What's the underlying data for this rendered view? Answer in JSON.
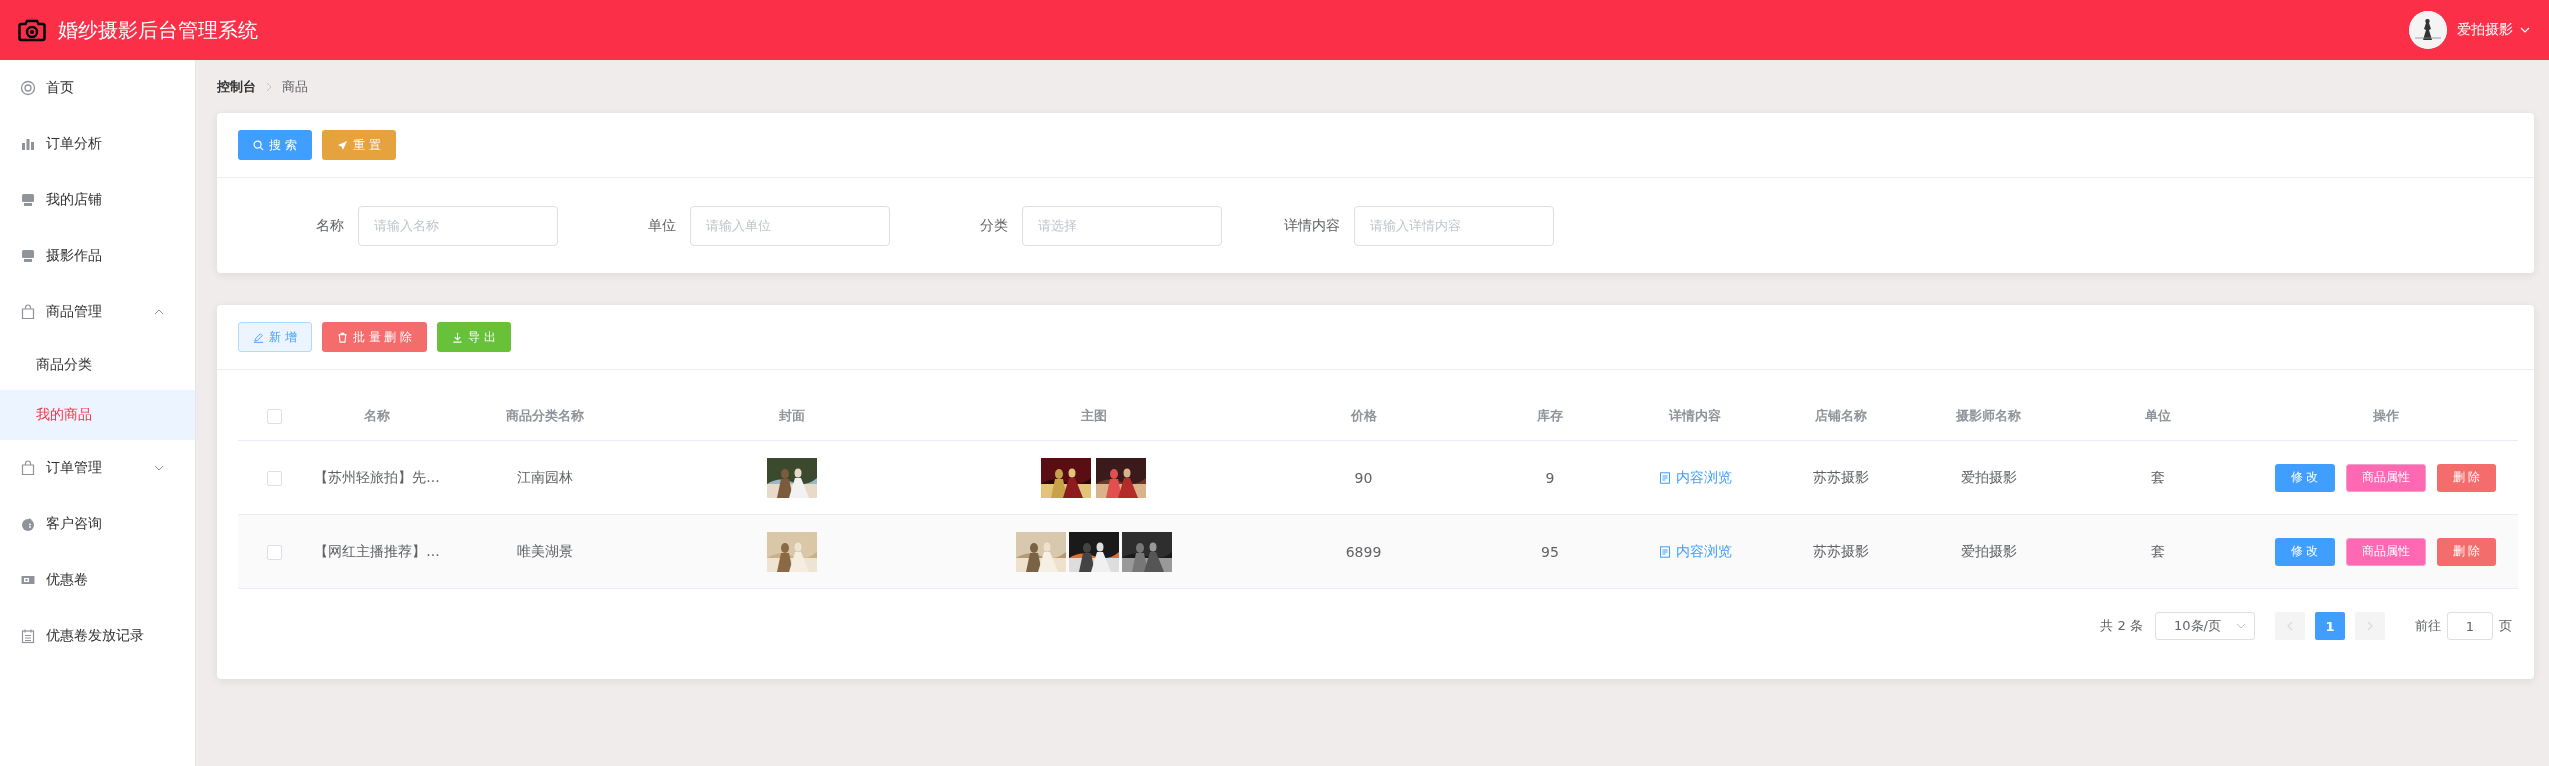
{
  "header": {
    "title": "婚纱摄影后台管理系统",
    "user": "爱拍摄影"
  },
  "sidebar": {
    "items": [
      {
        "label": "首页",
        "selected": false
      },
      {
        "label": "订单分析",
        "selected": false
      },
      {
        "label": "我的店铺",
        "selected": false
      },
      {
        "label": "摄影作品",
        "selected": false
      },
      {
        "label": "商品管理",
        "selected": false,
        "expanded": true,
        "children": [
          {
            "label": "商品分类",
            "selected": false
          },
          {
            "label": "我的商品",
            "selected": true
          }
        ]
      },
      {
        "label": "订单管理",
        "selected": false,
        "expanded": false
      },
      {
        "label": "客户咨询",
        "selected": false
      },
      {
        "label": "优惠卷",
        "selected": false
      },
      {
        "label": "优惠卷发放记录",
        "selected": false
      }
    ]
  },
  "breadcrumb": [
    "控制台",
    "商品"
  ],
  "search_panel": {
    "buttons": [
      {
        "kind": "search",
        "label": "搜 索"
      },
      {
        "kind": "reset",
        "label": "重 置"
      }
    ],
    "fields": [
      {
        "label": "名称",
        "placeholder": "请输入名称"
      },
      {
        "label": "单位",
        "placeholder": "请输入单位"
      },
      {
        "label": "分类",
        "placeholder": "请选择"
      },
      {
        "label": "详情内容",
        "placeholder": "请输入详情内容"
      }
    ]
  },
  "toolbar": [
    {
      "kind": "add",
      "label": "新 增"
    },
    {
      "kind": "batch-delete",
      "label": "批 量 删 除"
    },
    {
      "kind": "export",
      "label": "导 出"
    }
  ],
  "table": {
    "select_all": {
      "checked": false
    },
    "columns": [
      "名称",
      "商品分类名称",
      "封面",
      "主图",
      "价格",
      "库存",
      "详情内容",
      "店铺名称",
      "摄影师名称",
      "单位",
      "操作"
    ],
    "rows": [
      {
        "checked": false,
        "name": "【苏州轻旅拍】先...",
        "category": "江南园林",
        "price": "90",
        "stock": "9",
        "detail_link": "内容浏览",
        "shop": "苏苏摄影",
        "photographer": "爱拍摄影",
        "unit": "套",
        "actions": [
          {
            "kind": "edit",
            "label": "修 改"
          },
          {
            "kind": "attributes",
            "label": "商品属性"
          },
          {
            "kind": "delete",
            "label": "删 除"
          }
        ]
      },
      {
        "checked": false,
        "name": "【网红主播推荐】...",
        "category": "唯美湖景",
        "price": "6899",
        "stock": "95",
        "detail_link": "内容浏览",
        "shop": "苏苏摄影",
        "photographer": "爱拍摄影",
        "unit": "套",
        "actions": [
          {
            "kind": "edit",
            "label": "修 改"
          },
          {
            "kind": "attributes",
            "label": "商品属性"
          },
          {
            "kind": "delete",
            "label": "删 除"
          }
        ]
      }
    ]
  },
  "pagination": {
    "total": "共 2 条",
    "page_size": "10条/页",
    "prev": {
      "disabled": true
    },
    "pages": [
      {
        "label": "1",
        "selected": true
      }
    ],
    "next": {
      "disabled": true
    },
    "goto_label": "前往",
    "goto_value": "1",
    "goto_suffix": "页"
  }
}
